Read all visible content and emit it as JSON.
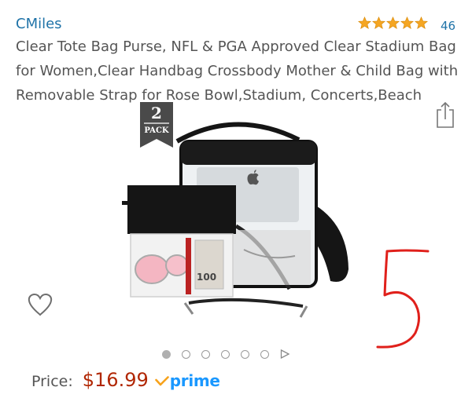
{
  "product": {
    "brand": "CMiles",
    "rating_stars": 5,
    "rating_count": "46",
    "title": "Clear Tote Bag Purse, NFL & PGA Approved Clear Stadium Bag for Women,Clear Handbag Crossbody Mother & Child Bag with Removable Strap for Rose Bowl,Stadium, Concerts,Beach",
    "image_badge": {
      "number": "2",
      "word": "PACK"
    },
    "image_bill_text": "100"
  },
  "gallery": {
    "total_images": 6,
    "active_index": 0,
    "icons": [
      "heart-icon",
      "share-icon",
      "play-icon"
    ]
  },
  "price": {
    "label": "Price:",
    "value": "$16.99",
    "prime_label": "prime"
  },
  "annotation": {
    "text": "5",
    "color": "#e0201b"
  },
  "colors": {
    "link": "#1f73a8",
    "price": "#b12704",
    "star": "#f5a623",
    "prime": "#1a98ff"
  }
}
